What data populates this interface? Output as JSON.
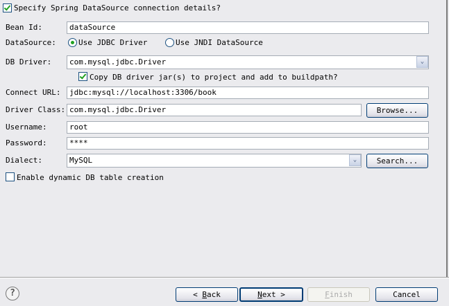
{
  "specify": {
    "label": "Specify Spring DataSource connection details?",
    "checked": true
  },
  "bean_id": {
    "label": "Bean Id:",
    "value": "dataSource"
  },
  "datasource": {
    "label": "DataSource:",
    "options": [
      "Use JDBC Driver",
      "Use JNDI DataSource"
    ],
    "selected": "Use JDBC Driver"
  },
  "db_driver": {
    "label": "DB Driver:",
    "value": "com.mysql.jdbc.Driver"
  },
  "copy_jar": {
    "label": "Copy DB driver jar(s) to project and add to buildpath?",
    "checked": true
  },
  "connect_url": {
    "label": "Connect URL:",
    "value": "jdbc:mysql://localhost:3306/book"
  },
  "driver_class": {
    "label": "Driver Class:",
    "value": "com.mysql.jdbc.Driver",
    "browse": "Browse..."
  },
  "username": {
    "label": "Username:",
    "value": "root"
  },
  "password": {
    "label": "Password:",
    "value": "****"
  },
  "dialect": {
    "label": "Dialect:",
    "value": "MySQL",
    "search": "Search..."
  },
  "dynamic": {
    "label": "Enable dynamic DB table creation",
    "checked": false
  },
  "footer": {
    "back_prefix": "< ",
    "back_key": "B",
    "back_rest": "ack",
    "next_key": "N",
    "next_rest": "ext >",
    "finish_key": "F",
    "finish_rest": "inish",
    "cancel": "Cancel"
  }
}
